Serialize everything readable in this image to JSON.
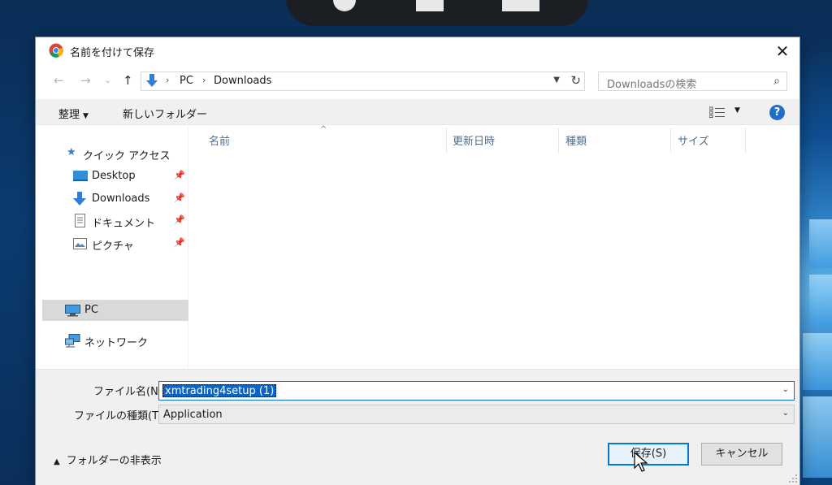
{
  "dialog": {
    "title": "名前を付けて保存",
    "close": "✕"
  },
  "nav": {
    "back": "←",
    "forward": "→",
    "dropdown": "⌄",
    "up": "↑",
    "path": [
      "PC",
      "Downloads"
    ],
    "separator": "›",
    "search_placeholder": "Downloadsの検索"
  },
  "toolbar": {
    "organize": "整理",
    "new_folder": "新しいフォルダー"
  },
  "sidebar": {
    "quick_access": "クイック アクセス",
    "items": [
      {
        "label": "Desktop",
        "icon": "desktop-icon",
        "pinned": true
      },
      {
        "label": "Downloads",
        "icon": "download-icon",
        "pinned": true
      },
      {
        "label": "ドキュメント",
        "icon": "document-icon",
        "pinned": true
      },
      {
        "label": "ピクチャ",
        "icon": "picture-icon",
        "pinned": true
      }
    ],
    "pc": "PC",
    "network": "ネットワーク"
  },
  "columns": [
    "名前",
    "更新日時",
    "種類",
    "サイズ"
  ],
  "form": {
    "filename_label": "ファイル名(N):",
    "filename_value": "xmtrading4setup (1)",
    "filetype_label": "ファイルの種類(T):",
    "filetype_value": "Application"
  },
  "footer": {
    "hide_folders": "フォルダーの非表示",
    "save": "保存(S)",
    "cancel": "キャンセル"
  },
  "colors": {
    "accent": "#0078d7",
    "selection": "#0a64c8",
    "column_header": "#4d6d8e"
  }
}
